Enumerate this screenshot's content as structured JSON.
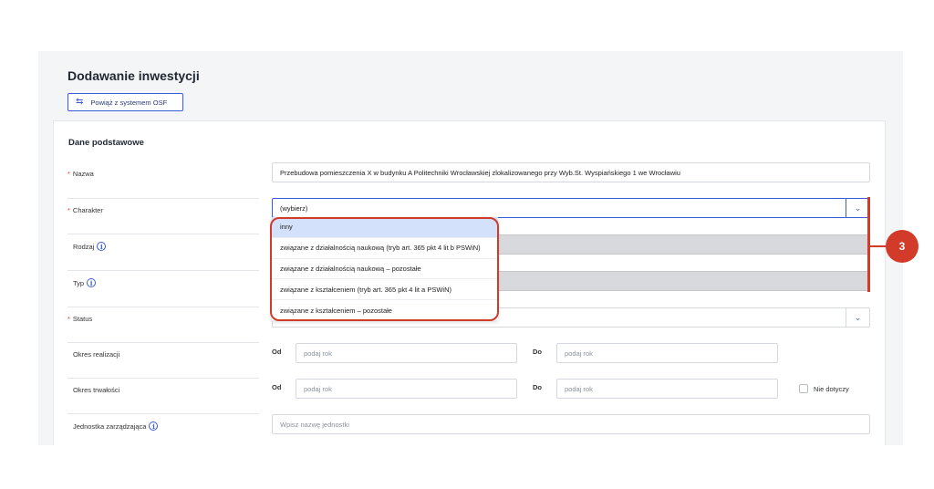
{
  "page": {
    "title": "Dodawanie inwestycji",
    "osf_button": "Powiąż z systemem OSF",
    "osf_icon": "swap-arrows-icon"
  },
  "section": {
    "title": "Dane podstawowe"
  },
  "fields": {
    "nazwa": {
      "required_mark": "*",
      "label": "Nazwa",
      "value": "Przebudowa pomieszczenia X w budynku A Politechniki Wrocławskiej zlokalizowanego przy Wyb.St. Wyspiańskiego 1 we Wrocławiu"
    },
    "charakter": {
      "required_mark": "*",
      "label": "Charakter",
      "value": "(wybierz)"
    },
    "rodzaj": {
      "label": "Rodzaj"
    },
    "typ": {
      "label": "Typ"
    },
    "status": {
      "required_mark": "*",
      "label": "Status",
      "value": ""
    },
    "okres_realizacji": {
      "label": "Okres realizacji",
      "od_label": "Od",
      "od_placeholder": "podaj rok",
      "do_label": "Do",
      "do_placeholder": "podaj rok"
    },
    "okres_trwalosci": {
      "label": "Okres trwałości",
      "od_label": "Od",
      "od_placeholder": "podaj rok",
      "do_label": "Do",
      "do_placeholder": "podaj rok",
      "nie_dotyczy": "Nie dotyczy",
      "nie_dotyczy_checked": false
    },
    "jednostka": {
      "label": "Jednostka zarządzająca",
      "placeholder": "Wpisz nazwę jednostki"
    }
  },
  "info_icon_glyph": "i",
  "chevron_glyph": "⌄",
  "dropdown": {
    "selected_index": 0,
    "options": [
      "inny",
      "związane z działalnością naukową (tryb art. 365 pkt 4 lit b PSWiN)",
      "związane z działalnością naukową – pozostałe",
      "związane z kształceniem (tryb art. 365 pkt 4 lit a PSWiN)",
      "związane z kształceniem – pozostałe"
    ]
  },
  "annotation": {
    "number": "3",
    "color": "#d23b2a"
  },
  "colors": {
    "accent": "#3b5bdb",
    "required": "#e03a2a",
    "highlight": "#d4e1fb"
  }
}
